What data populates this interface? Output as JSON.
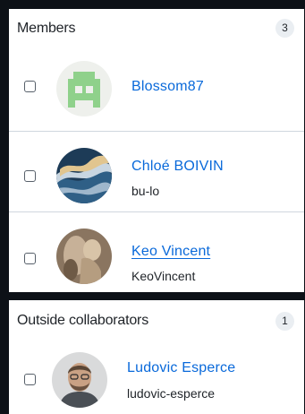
{
  "members": {
    "title": "Members",
    "count": "3",
    "rows": [
      {
        "name": "Blossom87",
        "login": "",
        "avatar": "identicon-avatar"
      },
      {
        "name": "Chloé BOIVIN",
        "login": "bu-lo",
        "avatar": "wave-art-avatar"
      },
      {
        "name": "Keo Vincent",
        "login": "KeoVincent",
        "avatar": "statue-photo-avatar"
      }
    ]
  },
  "outside_collaborators": {
    "title": "Outside collaborators",
    "count": "1",
    "rows": [
      {
        "name": "Ludovic Esperce",
        "login": "ludovic-esperce",
        "avatar": "person-photo-avatar"
      }
    ]
  },
  "colors": {
    "link": "#0969da",
    "page_background": "#0d1117",
    "border": "#d0d7de"
  }
}
